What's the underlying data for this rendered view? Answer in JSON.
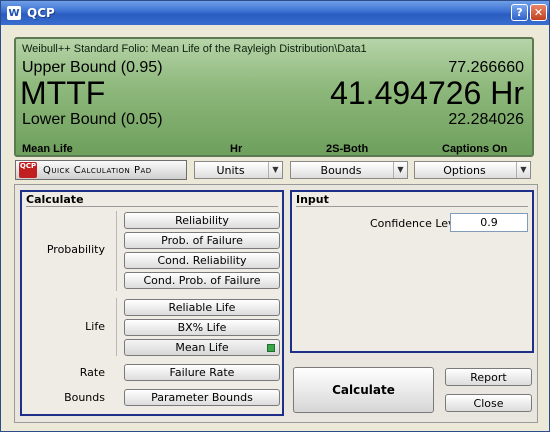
{
  "window": {
    "title": "QCP",
    "help_btn": "?",
    "close_btn": "✕",
    "app_icon": "W"
  },
  "display": {
    "folio_path": "Weibull++ Standard Folio: Mean Life of the Rayleigh Distribution\\Data1",
    "upper_label": "Upper Bound (0.95)",
    "upper_value": "77.266660",
    "main_label": "MTTF",
    "main_value": "41.494726 Hr",
    "lower_label": "Lower Bound (0.05)",
    "lower_value": "22.284026",
    "status": [
      "Mean Life",
      "Hr",
      "2S-Both",
      "Captions On"
    ]
  },
  "toolbar": {
    "qcp_logo": "QCP",
    "qcp_label": "Quick Calculation Pad",
    "units": "Units",
    "bounds": "Bounds",
    "options": "Options"
  },
  "calculate": {
    "title": "Calculate",
    "probability_label": "Probability",
    "life_label": "Life",
    "rate_label": "Rate",
    "bounds_label": "Bounds",
    "reliability": "Reliability",
    "prob_failure": "Prob. of Failure",
    "cond_reliability": "Cond. Reliability",
    "cond_prob_failure": "Cond. Prob. of Failure",
    "reliable_life": "Reliable Life",
    "bx_life": "BX% Life",
    "mean_life": "Mean Life",
    "failure_rate": "Failure Rate",
    "parameter_bounds": "Parameter Bounds"
  },
  "input": {
    "title": "Input",
    "confidence_label": "Confidence Level",
    "confidence_value": "0.9"
  },
  "actions": {
    "calculate": "Calculate",
    "report": "Report",
    "close": "Close"
  }
}
